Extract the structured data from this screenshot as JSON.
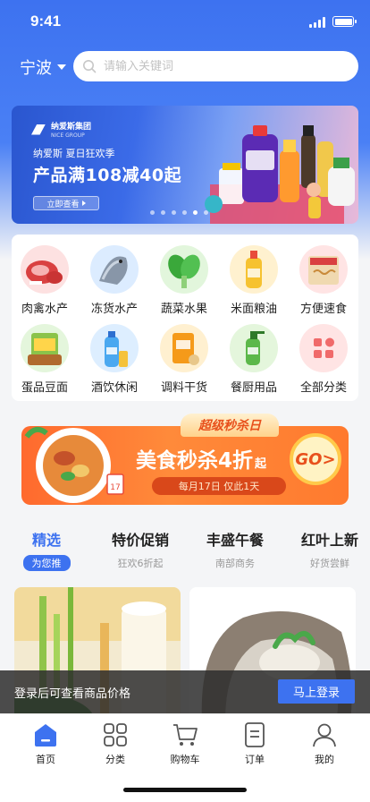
{
  "status_bar": {
    "time": "9:41"
  },
  "header": {
    "city": "宁波",
    "search_placeholder": "请输入关键词"
  },
  "banner": {
    "brand": "纳爱斯集团",
    "brand_sub": "NICE GROUP",
    "subtitle": "纳爱斯  夏日狂欢季",
    "title": "产品满108减40起",
    "button": "立即查看",
    "dot_count": 6,
    "active_dot": 5
  },
  "categories": [
    {
      "label": "肉禽水产",
      "icon": "meat-icon",
      "bg": "#fde1e1"
    },
    {
      "label": "冻货水产",
      "icon": "fish-icon",
      "bg": "#dcecff"
    },
    {
      "label": "蔬菜水果",
      "icon": "vegetable-icon",
      "bg": "#e2f6dc"
    },
    {
      "label": "米面粮油",
      "icon": "oil-icon",
      "bg": "#fff1cf"
    },
    {
      "label": "方便速食",
      "icon": "noodle-icon",
      "bg": "#ffe4e4"
    },
    {
      "label": "蛋品豆面",
      "icon": "egg-icon",
      "bg": "#e4f6dc"
    },
    {
      "label": "酒饮休闲",
      "icon": "drink-icon",
      "bg": "#ddeeff"
    },
    {
      "label": "调料干货",
      "icon": "seasoning-icon",
      "bg": "#fff0d0"
    },
    {
      "label": "餐厨用品",
      "icon": "kitchen-icon",
      "bg": "#e4f6dc"
    },
    {
      "label": "全部分类",
      "icon": "all-categories-icon",
      "bg": "#ffe4e4"
    }
  ],
  "flash_sale": {
    "tag": "超级秒杀日",
    "title": "美食秒杀4折",
    "title_suffix": "起",
    "subtitle": "每月17日 仅此1天",
    "go": "GO>",
    "calendar_day": "17"
  },
  "tabs": [
    {
      "title": "精选",
      "subtitle": "为您推",
      "active": true
    },
    {
      "title": "特价促销",
      "subtitle": "狂欢6折起",
      "active": false
    },
    {
      "title": "丰盛午餐",
      "subtitle": "南部商务",
      "active": false
    },
    {
      "title": "红叶上新",
      "subtitle": "好货尝鲜",
      "active": false
    }
  ],
  "login_bar": {
    "text": "登录后可查看商品价格",
    "button": "马上登录"
  },
  "tabbar": [
    {
      "label": "首页",
      "icon": "home-icon",
      "active": true
    },
    {
      "label": "分类",
      "icon": "category-grid-icon",
      "active": false
    },
    {
      "label": "购物车",
      "icon": "cart-icon",
      "active": false
    },
    {
      "label": "订单",
      "icon": "order-icon",
      "active": false
    },
    {
      "label": "我的",
      "icon": "profile-icon",
      "active": false
    }
  ],
  "colors": {
    "primary": "#3d72f0",
    "flash_orange": "#ff7a2e"
  }
}
